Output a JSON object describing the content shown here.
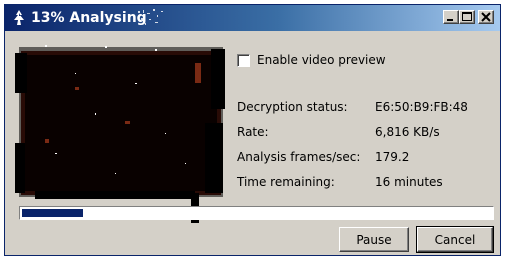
{
  "window": {
    "title": "13% Analysing",
    "controls": [
      "minimize",
      "maximize",
      "close"
    ]
  },
  "options": {
    "video_preview_label": "Enable video preview",
    "video_preview_checked": false
  },
  "stats": [
    {
      "label": "Decryption status:",
      "value": "E6:50:B9:FB:48"
    },
    {
      "label": "Rate:",
      "value": "6,816 KB/s"
    },
    {
      "label": "Analysis frames/sec:",
      "value": "179.2"
    },
    {
      "label": "Time remaining:",
      "value": "16 minutes"
    }
  ],
  "progress": {
    "fraction": 0.13,
    "color": "#0a246a"
  },
  "buttons": {
    "pause": "Pause",
    "cancel": "Cancel"
  },
  "icons": {
    "app": "dvd-icon",
    "minimize": "minimize-icon",
    "maximize": "maximize-icon",
    "close": "close-icon"
  }
}
